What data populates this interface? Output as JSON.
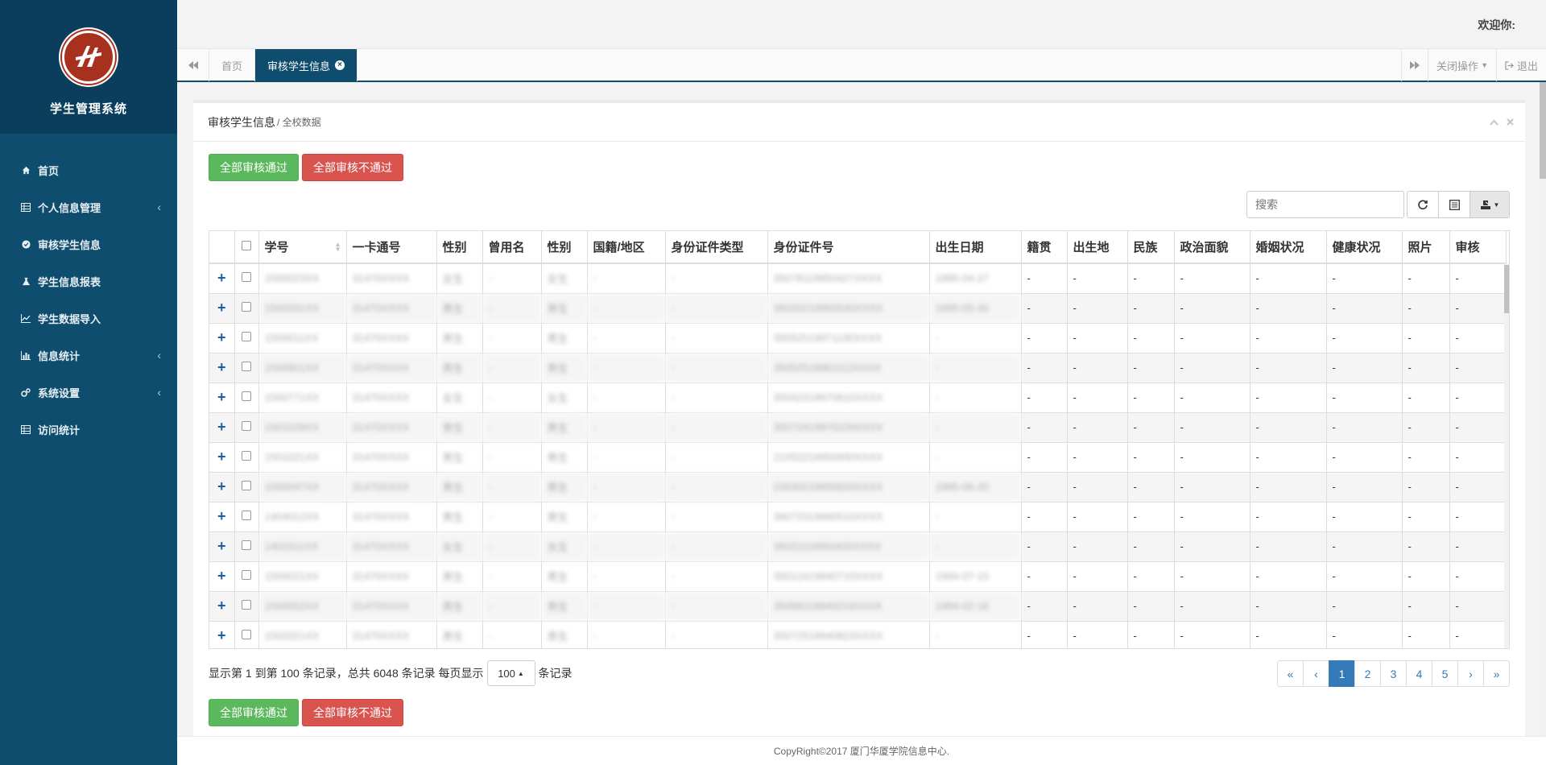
{
  "app": {
    "title": "学生管理系统"
  },
  "sidebar": {
    "items": [
      {
        "label": "首页",
        "icon": "home-icon",
        "expandable": false
      },
      {
        "label": "个人信息管理",
        "icon": "table-icon",
        "expandable": true
      },
      {
        "label": "审核学生信息",
        "icon": "check-circle-icon",
        "expandable": false
      },
      {
        "label": "学生信息报表",
        "icon": "flask-icon",
        "expandable": false
      },
      {
        "label": "学生数据导入",
        "icon": "line-chart-icon",
        "expandable": false
      },
      {
        "label": "信息统计",
        "icon": "bar-chart-icon",
        "expandable": true
      },
      {
        "label": "系统设置",
        "icon": "gears-icon",
        "expandable": true
      },
      {
        "label": "访问统计",
        "icon": "table-icon",
        "expandable": false
      }
    ]
  },
  "header": {
    "welcome": "欢迎你:"
  },
  "tabs": {
    "items": [
      {
        "label": "首页",
        "active": false
      },
      {
        "label": "审核学生信息",
        "active": true
      }
    ],
    "close_ops": "关闭操作",
    "logout": "退出"
  },
  "panel": {
    "title": "审核学生信息",
    "subtitle": "/ 全校数据",
    "approve_all": "全部审核通过",
    "reject_all": "全部审核不通过",
    "search_placeholder": "搜索"
  },
  "table": {
    "columns": [
      "学号",
      "一卡通号",
      "性别",
      "曾用名",
      "性别",
      "国籍/地区",
      "身份证件类型",
      "身份证件号",
      "出生日期",
      "籍贯",
      "出生地",
      "民族",
      "政治面貌",
      "婚姻状况",
      "健康状况",
      "照片",
      "审核"
    ],
    "rows": [
      [
        "1500023XX",
        "31470XXXX",
        "女生",
        "-",
        "女生",
        "-",
        "-",
        "35078119950427XXXX",
        "1995-04-27",
        "-",
        "-",
        "-",
        "-",
        "-",
        "-",
        "-",
        "-"
      ],
      [
        "1500261XX",
        "31470XXXX",
        "男生",
        "-",
        "男生",
        "-",
        "-",
        "35020219950530XXXX",
        "1995-05-30",
        "-",
        "-",
        "-",
        "-",
        "-",
        "-",
        "-",
        "-"
      ],
      [
        "1500011XX",
        "31470XXXX",
        "男生",
        "-",
        "男生",
        "-",
        "-",
        "35052519971130XXXX",
        "-",
        "-",
        "-",
        "-",
        "-",
        "-",
        "-",
        "-",
        "-"
      ],
      [
        "1500601XX",
        "31470XXXX",
        "男生",
        "-",
        "男生",
        "-",
        "-",
        "35052519961112XXXX",
        "-",
        "-",
        "-",
        "-",
        "-",
        "-",
        "-",
        "-",
        "-"
      ],
      [
        "1500771XX",
        "31470XXXX",
        "女生",
        "-",
        "女生",
        "-",
        "-",
        "35042319970810XXXX",
        "-",
        "-",
        "-",
        "-",
        "-",
        "-",
        "-",
        "-",
        "-"
      ],
      [
        "1501028XX",
        "31470XXXX",
        "男生",
        "-",
        "男生",
        "-",
        "-",
        "35072419970229XXXX",
        "-",
        "-",
        "-",
        "-",
        "-",
        "-",
        "-",
        "-",
        "-"
      ],
      [
        "1501021XX",
        "31470XXXX",
        "男生",
        "-",
        "男生",
        "-",
        "-",
        "21052219950930XXXX",
        "-",
        "-",
        "-",
        "-",
        "-",
        "-",
        "-",
        "-",
        "-"
      ],
      [
        "1500047XX",
        "31470XXXX",
        "男生",
        "-",
        "男生",
        "-",
        "-",
        "23030219950620XXXX",
        "1995-06-20",
        "-",
        "-",
        "-",
        "-",
        "-",
        "-",
        "-",
        "-"
      ],
      [
        "1404012XX",
        "31470XXXX",
        "男生",
        "-",
        "男生",
        "-",
        "-",
        "36072319960510XXXX",
        "-",
        "-",
        "-",
        "-",
        "-",
        "-",
        "-",
        "-",
        "-"
      ],
      [
        "1402311XX",
        "31470XXXX",
        "女生",
        "-",
        "女生",
        "-",
        "-",
        "35021119950420XXXX",
        "-",
        "-",
        "-",
        "-",
        "-",
        "-",
        "-",
        "-",
        "-"
      ],
      [
        "1500021XX",
        "31470XXXX",
        "男生",
        "-",
        "男生",
        "-",
        "-",
        "35012419940715XXXX",
        "1994-07-15",
        "-",
        "-",
        "-",
        "-",
        "-",
        "-",
        "-",
        "-"
      ],
      [
        "1500052XX",
        "31470XXXX",
        "男生",
        "-",
        "男生",
        "-",
        "-",
        "35068119940216XXXX",
        "1994-02-16",
        "-",
        "-",
        "-",
        "-",
        "-",
        "-",
        "-",
        "-"
      ],
      [
        "1502021XX",
        "31470XXXX",
        "男生",
        "-",
        "男生",
        "-",
        "-",
        "35072519940823XXXX",
        "-",
        "-",
        "-",
        "-",
        "-",
        "-",
        "-",
        "-",
        "-"
      ]
    ]
  },
  "pagination": {
    "info_prefix": "显示第 1 到第 100 条记录，总共 6048 条记录 每页显示",
    "page_size": "100",
    "info_suffix": "条记录",
    "pages": [
      "«",
      "‹",
      "1",
      "2",
      "3",
      "4",
      "5",
      "›",
      "»"
    ],
    "active_page": "1"
  },
  "footer": {
    "text": "CopyRight©2017 厦门华厦学院信息中心."
  },
  "colors": {
    "sidebar": "#0e4d6e",
    "approve": "#5cb85c",
    "reject": "#d9534f",
    "accent": "#337ab7"
  }
}
